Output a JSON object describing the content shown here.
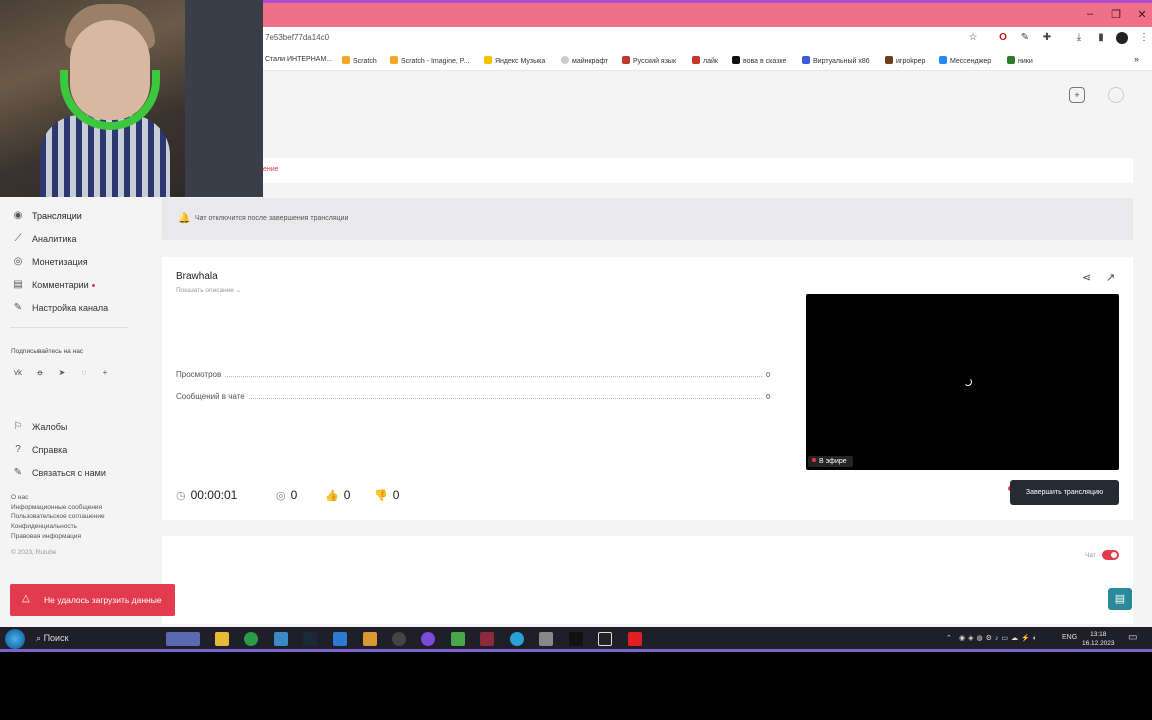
{
  "browser": {
    "url_fragment": "7e53bef77da14c0",
    "bookmarks": [
      {
        "label": "Стали ИНТЕРНАМ...",
        "color": "#888888"
      },
      {
        "label": "Scratch",
        "color": "#f5a623"
      },
      {
        "label": "Scratch - Imagine, P...",
        "color": "#f5a623"
      },
      {
        "label": "Яндекс Музыка",
        "color": "#f5c400"
      },
      {
        "label": "майнкрафт",
        "color": "#cccccc"
      },
      {
        "label": "Русский язык",
        "color": "#c0392b"
      },
      {
        "label": "лайк",
        "color": "#c0392b"
      },
      {
        "label": "вова в сказке",
        "color": "#111111"
      },
      {
        "label": "Виртуальный х86",
        "color": "#3b5bdb"
      },
      {
        "label": "игроkрeр",
        "color": "#6b3d1b"
      },
      {
        "label": "Мессенджер",
        "color": "#2787f5"
      },
      {
        "label": "ники",
        "color": "#2c7a2c"
      }
    ]
  },
  "page": {
    "tab_partial": "ение"
  },
  "sidebar": {
    "items": [
      {
        "label": "Трансляции",
        "icon": "broadcast-icon"
      },
      {
        "label": "Аналитика",
        "icon": "chart-icon"
      },
      {
        "label": "Монетизация",
        "icon": "coin-icon"
      },
      {
        "label": "Комментарии",
        "icon": "comments-icon"
      },
      {
        "label": "Настройка канала",
        "icon": "wand-icon"
      }
    ],
    "subscribe_label": "Подписывайтесь на нас",
    "secondary": [
      {
        "label": "Жалобы",
        "icon": "flag-icon"
      },
      {
        "label": "Справка",
        "icon": "help-icon"
      },
      {
        "label": "Связаться с нами",
        "icon": "pencil-icon"
      }
    ],
    "footer_links": [
      "О нас",
      "Информационные сообщения",
      "Пользовательское соглашение",
      "Конфиденциальность",
      "Правовая информация"
    ],
    "copyright": "© 2023, Rutube"
  },
  "notice": {
    "text": "Чат отключится после завершения трансляции"
  },
  "stream": {
    "title": "Brawhala",
    "show_description": "Показать описание",
    "stats": [
      {
        "label": "Просмотров",
        "value": "0"
      },
      {
        "label": "Сообщений в чате",
        "value": "0"
      }
    ],
    "duration": "00:00:01",
    "viewers": "0",
    "likes": "0",
    "dislikes": "0",
    "live_badge": "В эфире",
    "end_button": "Завершить трансляцию"
  },
  "chat": {
    "label": "Чат",
    "enabled": true
  },
  "toast": {
    "text": "Не удалось загрузить данные"
  },
  "taskbar": {
    "search": "Поиск",
    "lang": "ENG",
    "time": "13:18",
    "date": "16.12.2023"
  },
  "colors": {
    "accent": "#e23b4d",
    "dark_button": "#262a33",
    "titlebar": "#f07088"
  }
}
